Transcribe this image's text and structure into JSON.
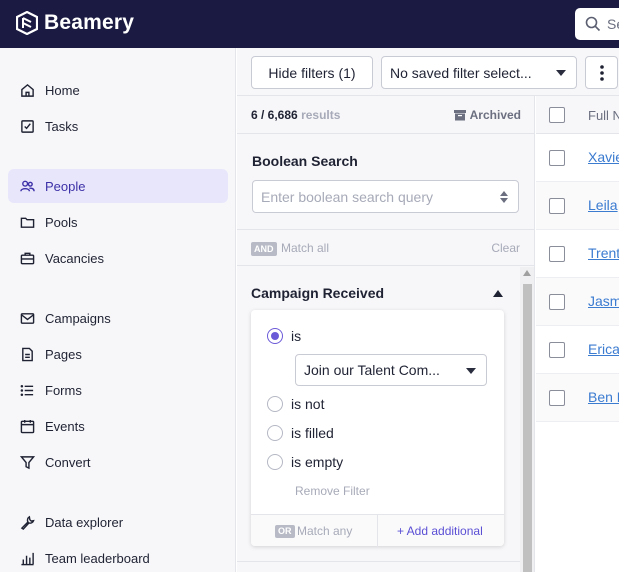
{
  "app": {
    "brand": "Beamery",
    "search_placeholder": "Se"
  },
  "sidebar": {
    "items": [
      {
        "label": "Home",
        "icon": "home-icon"
      },
      {
        "label": "Tasks",
        "icon": "tasks-icon"
      },
      {
        "label": "People",
        "icon": "people-icon",
        "active": true
      },
      {
        "label": "Pools",
        "icon": "folder-icon"
      },
      {
        "label": "Vacancies",
        "icon": "briefcase-icon"
      },
      {
        "label": "Campaigns",
        "icon": "mail-icon"
      },
      {
        "label": "Pages",
        "icon": "page-icon"
      },
      {
        "label": "Forms",
        "icon": "list-icon"
      },
      {
        "label": "Events",
        "icon": "calendar-icon"
      },
      {
        "label": "Convert",
        "icon": "funnel-icon"
      },
      {
        "label": "Data explorer",
        "icon": "wrench-icon"
      },
      {
        "label": "Team leaderboard",
        "icon": "chart-icon"
      }
    ]
  },
  "toolbar": {
    "hide_filters_label": "Hide filters (1)",
    "saved_filter_value": "No saved filter select..."
  },
  "filters": {
    "results_count": "6 / 6,686",
    "results_word": "results",
    "archived_label": "Archived",
    "boolean_title": "Boolean Search",
    "boolean_placeholder": "Enter boolean search query",
    "and_badge": "AND",
    "match_all_label": "Match all",
    "clear_label": "Clear",
    "campaign_title": "Campaign Received",
    "options": {
      "is": "is",
      "is_not": "is not",
      "is_filled": "is filled",
      "is_empty": "is empty"
    },
    "selected_option": "is",
    "campaign_value": "Join our Talent Com...",
    "remove_filter_label": "Remove Filter",
    "or_badge": "OR",
    "match_any_label": "Match any",
    "add_additional_label": "+ Add additional"
  },
  "table": {
    "column_header": "Full N",
    "rows": [
      "Xavie",
      "Leila",
      "Trent",
      "Jasm",
      "Erica",
      "Ben D"
    ]
  },
  "colors": {
    "topbar": "#1b1a42",
    "accent": "#6b5ad8",
    "link": "#3b7bd0",
    "active_nav_bg": "#e8e6fb"
  }
}
